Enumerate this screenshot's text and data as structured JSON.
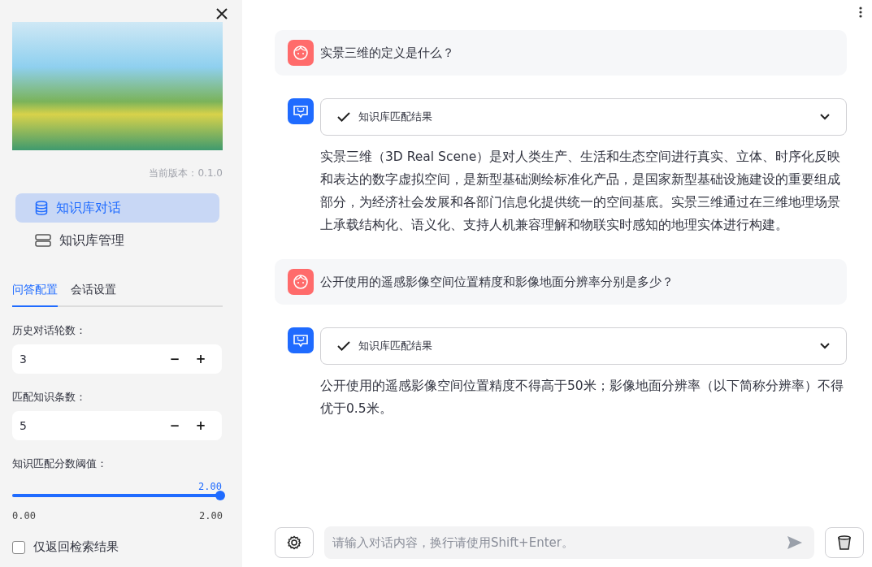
{
  "sidebar": {
    "version": "当前版本：0.1.0",
    "nav": [
      {
        "label": "知识库对话",
        "selected": true
      },
      {
        "label": "知识库管理",
        "selected": false
      }
    ],
    "tabs": [
      {
        "label": "问答配置",
        "selected": true
      },
      {
        "label": "会话设置",
        "selected": false
      }
    ],
    "settings": [
      {
        "kind": "number",
        "label": "历史对话轮数：",
        "value": "3",
        "minus": "−",
        "plus": "+"
      },
      {
        "kind": "number",
        "label": "匹配知识条数：",
        "value": "5",
        "minus": "−",
        "plus": "+"
      },
      {
        "kind": "slider",
        "label": "知识匹配分数阈值：",
        "value": "2.00",
        "min": "0.00",
        "max": "2.00",
        "level": 1
      },
      {
        "kind": "checkbox",
        "label": "仅返回检索结果",
        "checked": false
      }
    ]
  },
  "messages": [
    {
      "kind": "user",
      "text": "实景三维的定义是什么？"
    },
    {
      "kind": "assistant",
      "expander": {
        "label": "知识库匹配结果",
        "expanded": false
      },
      "text": "实景三维（3D Real Scene）是对人类生产、生活和生态空间进行真实、立体、时序化反映和表达的数字虚拟空间，是新型基础测绘标准化产品，是国家新型基础设施建设的重要组成部分，为经济社会发展和各部门信息化提供统一的空间基底。实景三维通过在三维地理场景上承载结构化、语义化、支持人机兼容理解和物联实时感知的地理实体进行构建。"
    },
    {
      "kind": "user",
      "text": "公开使用的遥感影像空间位置精度和影像地面分辨率分别是多少？"
    },
    {
      "kind": "assistant",
      "expander": {
        "label": "知识库匹配结果",
        "expanded": false
      },
      "text": "公开使用的遥感影像空间位置精度不得高于50米；影像地面分辨率（以下简称分辨率）不得优于0.5米。"
    }
  ],
  "input": {
    "placeholder": "请输入对话内容，换行请使用Shift+Enter。"
  }
}
